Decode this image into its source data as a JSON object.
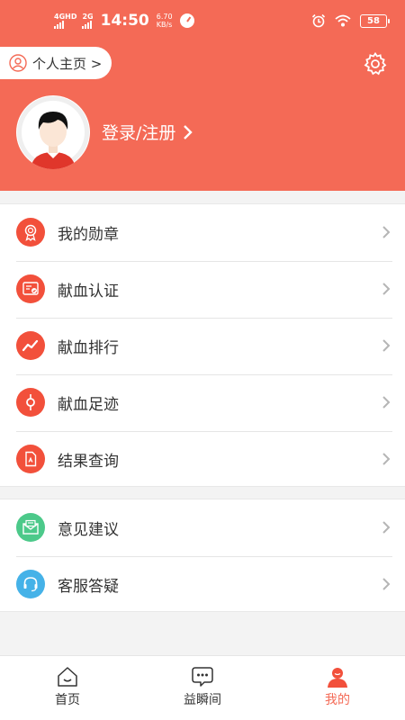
{
  "status_bar": {
    "net1": "4GHD",
    "net2": "2G",
    "time": "14:50",
    "speed_value": "6.70",
    "speed_unit": "KB/s",
    "battery": "58"
  },
  "header": {
    "home_label": "个人主页 >",
    "login_label": "登录/注册"
  },
  "menu_group_1": [
    {
      "label": "我的勋章",
      "icon": "medal-icon",
      "color": "#f2503b"
    },
    {
      "label": "献血认证",
      "icon": "certificate-icon",
      "color": "#f2503b"
    },
    {
      "label": "献血排行",
      "icon": "trend-chart-icon",
      "color": "#f2503b"
    },
    {
      "label": "献血足迹",
      "icon": "location-pin-icon",
      "color": "#f2503b"
    },
    {
      "label": "结果查询",
      "icon": "document-icon",
      "color": "#f2503b"
    }
  ],
  "menu_group_2": [
    {
      "label": "意见建议",
      "icon": "mail-icon",
      "color": "#4cc98a"
    },
    {
      "label": "客服答疑",
      "icon": "headset-icon",
      "color": "#45b2e8"
    }
  ],
  "tabs": [
    {
      "label": "首页",
      "icon": "home-icon",
      "active": false
    },
    {
      "label": "益瞬间",
      "icon": "chat-bubble-icon",
      "active": false
    },
    {
      "label": "我的",
      "icon": "user-icon",
      "active": true
    }
  ],
  "colors": {
    "brand": "#f46a56",
    "accent_red": "#f2503b",
    "green": "#4cc98a",
    "blue": "#45b2e8"
  }
}
